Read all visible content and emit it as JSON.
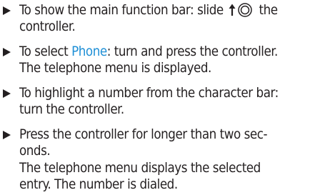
{
  "steps": [
    {
      "lines": [
        {
          "before": "To show the main function bar: slide ",
          "after": " the"
        },
        {
          "text": "controller."
        }
      ],
      "icon": "slide-up-controller-icon"
    },
    {
      "line1_before": "To select ",
      "keyword": "Phone",
      "line1_after": ": turn and press the controller.",
      "line2": "The telephone menu is displayed."
    },
    {
      "line1": "To highlight a number from the character bar:",
      "line2": "turn the controller."
    },
    {
      "line1": "Press the controller for longer than two sec-",
      "line2": "onds.",
      "line3": "The telephone menu displays the selected",
      "line4": "entry. The number is dialed."
    }
  ],
  "colors": {
    "text": "#231f20",
    "keyword": "#1e8fd6"
  }
}
